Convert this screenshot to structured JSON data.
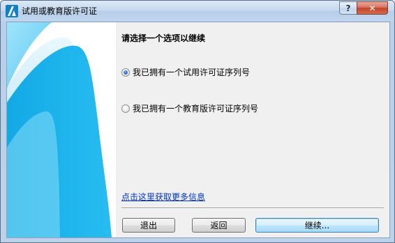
{
  "window": {
    "title": "试用或教育版许可证",
    "help_label": "?",
    "close_label": "✕",
    "app_icon": "autodesk-a-logo-icon"
  },
  "content": {
    "heading": "请选择一个选项以继续",
    "options": [
      {
        "label": "我已拥有一个试用许可证序列号",
        "checked": true
      },
      {
        "label": "我已拥有一个教育版许可证序列号",
        "checked": false
      }
    ],
    "more_info_link": "点击这里获取更多信息"
  },
  "buttons": {
    "exit": "退出",
    "back": "返回",
    "continue": "继续..."
  },
  "colors": {
    "side_accent": "#1fb6ef",
    "link": "#0033cc",
    "title_bar": "#c5d9ef",
    "close_button": "#c4442b"
  }
}
